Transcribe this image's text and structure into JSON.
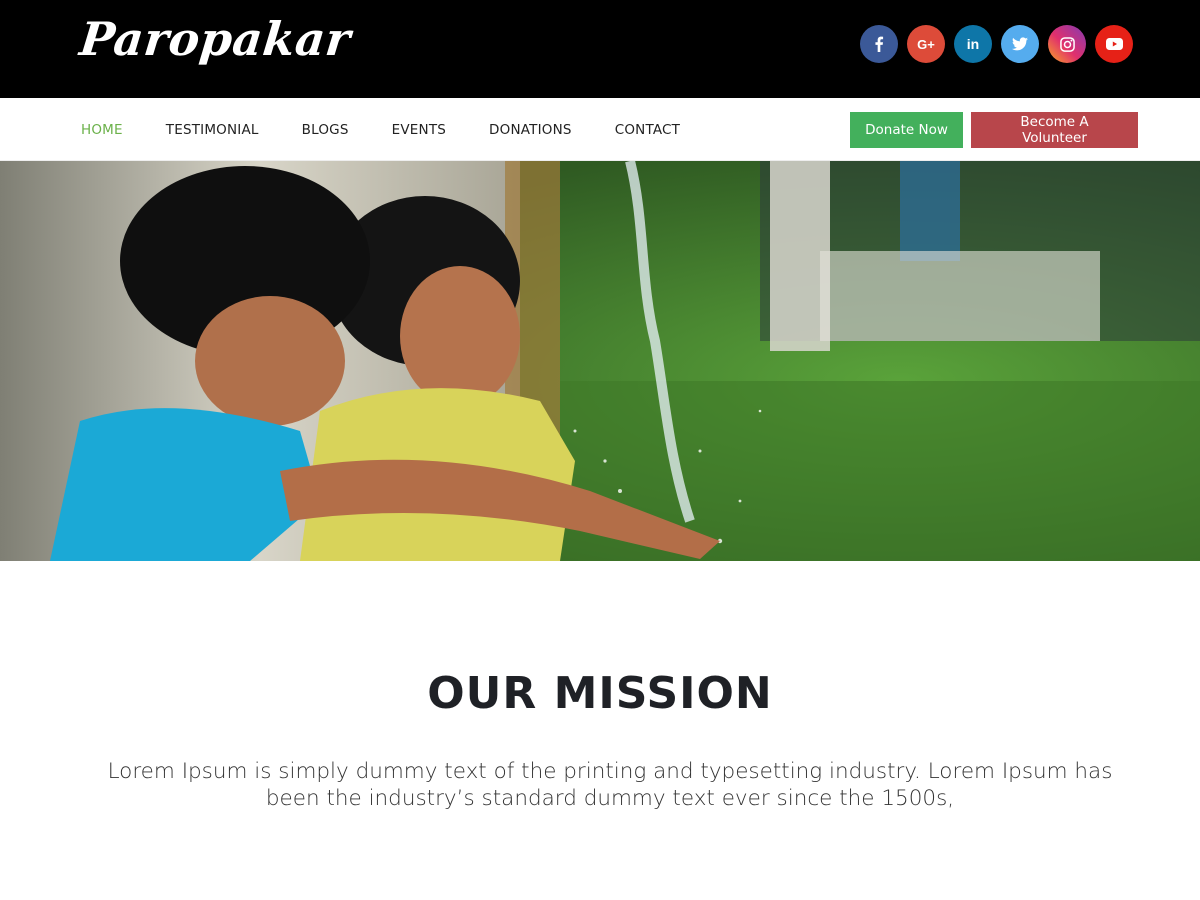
{
  "header": {
    "logo": "Paropakar",
    "social": [
      {
        "name": "facebook",
        "glyph": "f",
        "color": "#3b5998"
      },
      {
        "name": "google-plus",
        "glyph": "G+",
        "color": "#dd4b39"
      },
      {
        "name": "linkedin",
        "glyph": "in",
        "color": "#0e76a8"
      },
      {
        "name": "twitter",
        "glyph": "twitter",
        "color": "#55acee"
      },
      {
        "name": "instagram",
        "glyph": "instagram",
        "color": "#c13584"
      },
      {
        "name": "youtube",
        "glyph": "youtube",
        "color": "#e62117"
      }
    ]
  },
  "nav": {
    "links": [
      {
        "label": "HOME",
        "active": true
      },
      {
        "label": "TESTIMONIAL",
        "active": false
      },
      {
        "label": "BLOGS",
        "active": false
      },
      {
        "label": "EVENTS",
        "active": false
      },
      {
        "label": "DONATIONS",
        "active": false
      },
      {
        "label": "CONTACT",
        "active": false
      }
    ],
    "donate_label": "Donate Now",
    "volunteer_label": "Become A Volunteer",
    "active_color": "#6bb14a",
    "donate_color": "#43b05c",
    "volunteer_color": "#b8464b"
  },
  "hero": {
    "image": "children-playing-with-water-photo"
  },
  "mission": {
    "title": "OUR MISSION",
    "text": "Lorem Ipsum is simply dummy text of the printing and typesetting industry. Lorem Ipsum has been the industry’s standard dummy text ever since the 1500s,"
  }
}
